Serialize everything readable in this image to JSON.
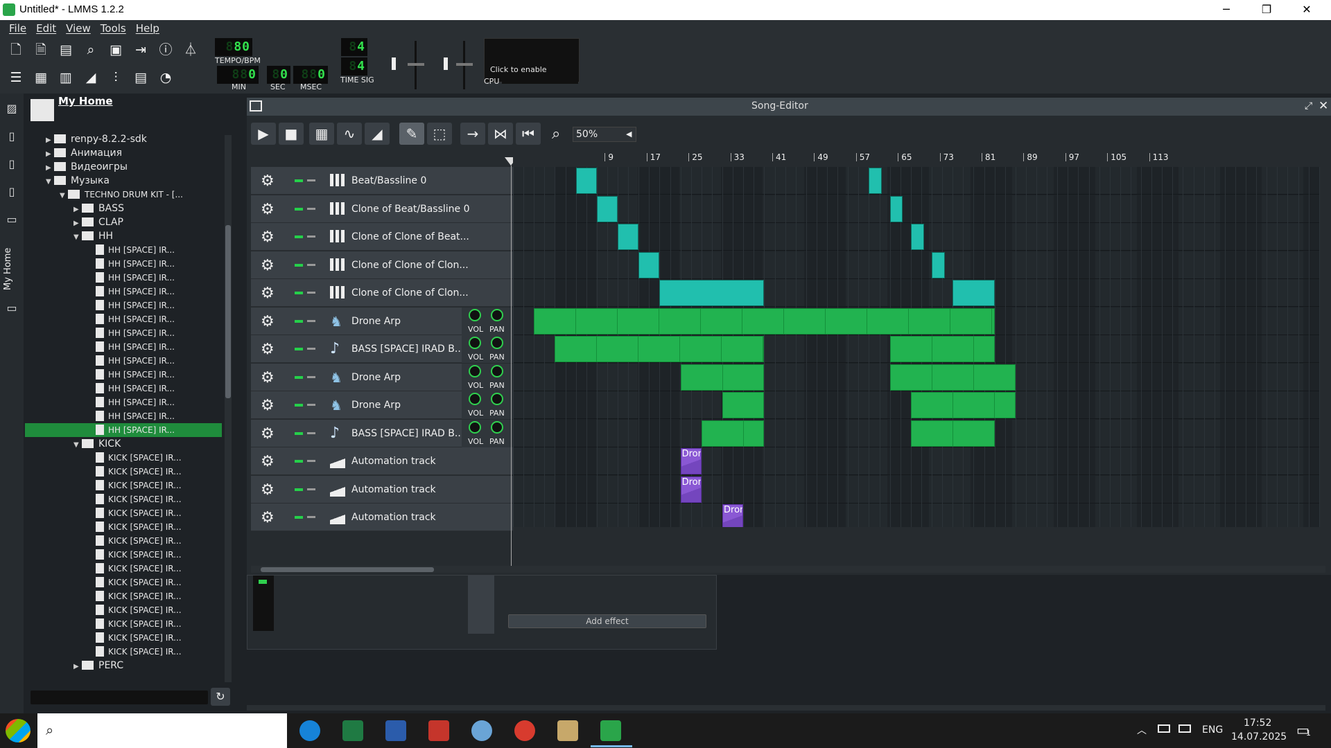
{
  "window": {
    "title": "Untitled* - LMMS 1.2.2",
    "controls": [
      "─",
      "❐",
      "✕"
    ]
  },
  "menu": [
    "File",
    "Edit",
    "View",
    "Tools",
    "Help"
  ],
  "transport": {
    "tempo_value": "80",
    "tempo_label": "TEMPO/BPM",
    "min_value": "0",
    "min_label": "MIN",
    "sec_value": "0",
    "sec_label": "SEC",
    "msec_value": "0",
    "msec_label": "MSEC",
    "timesig_num": "4",
    "timesig_den": "4",
    "timesig_label": "TIME SIG",
    "cpu_hint": "Click to enable",
    "cpu_label": "CPU"
  },
  "browser": {
    "title": "My Home",
    "side_tab_label": "My Home",
    "rows": [
      {
        "label": "renpy-8.2.2-sdk",
        "kind": "folder",
        "arrow": "▶",
        "level": 0
      },
      {
        "label": "Анимация",
        "kind": "folder",
        "arrow": "▶",
        "level": 0
      },
      {
        "label": "Видеоигры",
        "kind": "folder",
        "arrow": "▶",
        "level": 0
      },
      {
        "label": "Музыка",
        "kind": "folder",
        "arrow": "▼",
        "level": 0
      },
      {
        "label": "TECHNO DRUM KIT - [...",
        "kind": "folder",
        "arrow": "▼",
        "level": 1
      },
      {
        "label": "BASS",
        "kind": "folder",
        "arrow": "▶",
        "level": 2
      },
      {
        "label": "CLAP",
        "kind": "folder",
        "arrow": "▶",
        "level": 2
      },
      {
        "label": "HH",
        "kind": "folder",
        "arrow": "▼",
        "level": 2
      },
      {
        "label": "HH [SPACE] IR...",
        "kind": "file",
        "arrow": "",
        "level": 3
      },
      {
        "label": "HH [SPACE] IR...",
        "kind": "file",
        "arrow": "",
        "level": 3
      },
      {
        "label": "HH [SPACE] IR...",
        "kind": "file",
        "arrow": "",
        "level": 3
      },
      {
        "label": "HH [SPACE] IR...",
        "kind": "file",
        "arrow": "",
        "level": 3
      },
      {
        "label": "HH [SPACE] IR...",
        "kind": "file",
        "arrow": "",
        "level": 3
      },
      {
        "label": "HH [SPACE] IR...",
        "kind": "file",
        "arrow": "",
        "level": 3
      },
      {
        "label": "HH [SPACE] IR...",
        "kind": "file",
        "arrow": "",
        "level": 3
      },
      {
        "label": "HH [SPACE] IR...",
        "kind": "file",
        "arrow": "",
        "level": 3
      },
      {
        "label": "HH [SPACE] IR...",
        "kind": "file",
        "arrow": "",
        "level": 3
      },
      {
        "label": "HH [SPACE] IR...",
        "kind": "file",
        "arrow": "",
        "level": 3
      },
      {
        "label": "HH [SPACE] IR...",
        "kind": "file",
        "arrow": "",
        "level": 3
      },
      {
        "label": "HH [SPACE] IR...",
        "kind": "file",
        "arrow": "",
        "level": 3
      },
      {
        "label": "HH [SPACE] IR...",
        "kind": "file",
        "arrow": "",
        "level": 3
      },
      {
        "label": "HH [SPACE] IR...",
        "kind": "file",
        "arrow": "",
        "level": 3,
        "selected": true
      },
      {
        "label": "KICK",
        "kind": "folder",
        "arrow": "▼",
        "level": 2
      },
      {
        "label": "KICK [SPACE] IR...",
        "kind": "file",
        "arrow": "",
        "level": 3
      },
      {
        "label": "KICK [SPACE] IR...",
        "kind": "file",
        "arrow": "",
        "level": 3
      },
      {
        "label": "KICK [SPACE] IR...",
        "kind": "file",
        "arrow": "",
        "level": 3
      },
      {
        "label": "KICK [SPACE] IR...",
        "kind": "file",
        "arrow": "",
        "level": 3
      },
      {
        "label": "KICK [SPACE] IR...",
        "kind": "file",
        "arrow": "",
        "level": 3
      },
      {
        "label": "KICK [SPACE] IR...",
        "kind": "file",
        "arrow": "",
        "level": 3
      },
      {
        "label": "KICK [SPACE] IR...",
        "kind": "file",
        "arrow": "",
        "level": 3
      },
      {
        "label": "KICK [SPACE] IR...",
        "kind": "file",
        "arrow": "",
        "level": 3
      },
      {
        "label": "KICK [SPACE] IR...",
        "kind": "file",
        "arrow": "",
        "level": 3
      },
      {
        "label": "KICK [SPACE] IR...",
        "kind": "file",
        "arrow": "",
        "level": 3
      },
      {
        "label": "KICK [SPACE] IR...",
        "kind": "file",
        "arrow": "",
        "level": 3
      },
      {
        "label": "KICK [SPACE] IR...",
        "kind": "file",
        "arrow": "",
        "level": 3
      },
      {
        "label": "KICK [SPACE] IR...",
        "kind": "file",
        "arrow": "",
        "level": 3
      },
      {
        "label": "KICK [SPACE] IR...",
        "kind": "file",
        "arrow": "",
        "level": 3
      },
      {
        "label": "KICK [SPACE] IR...",
        "kind": "file",
        "arrow": "",
        "level": 3
      },
      {
        "label": "PERC",
        "kind": "folder",
        "arrow": "▶",
        "level": 2
      }
    ]
  },
  "song_editor": {
    "title": "Song-Editor",
    "zoom": "50%",
    "ruler": [
      "9",
      "17",
      "25",
      "33",
      "41",
      "49",
      "57",
      "65",
      "73",
      "81",
      "89",
      "97",
      "105",
      "113"
    ],
    "tracks": [
      {
        "name": "Beat/Bassline 0",
        "type": "beat"
      },
      {
        "name": "Clone of Beat/Bassline 0",
        "type": "beat"
      },
      {
        "name": "Clone of Clone of Beat...",
        "type": "beat"
      },
      {
        "name": "Clone of Clone of Clon...",
        "type": "beat"
      },
      {
        "name": "Clone of Clone of Clon...",
        "type": "beat"
      },
      {
        "name": "Drone Arp",
        "type": "inst"
      },
      {
        "name": "BASS [SPACE] IRAD B...",
        "type": "sample"
      },
      {
        "name": "Drone Arp",
        "type": "inst"
      },
      {
        "name": "Drone Arp",
        "type": "inst"
      },
      {
        "name": "BASS [SPACE] IRAD B...",
        "type": "sample"
      },
      {
        "name": "Automation track",
        "type": "auto"
      },
      {
        "name": "Automation track",
        "type": "auto"
      },
      {
        "name": "Automation track",
        "type": "auto"
      }
    ],
    "vol_label": "VOL",
    "pan_label": "PAN",
    "clips": [
      {
        "track": 0,
        "start": 13,
        "end": 17,
        "kind": "beat"
      },
      {
        "track": 0,
        "start": 69,
        "end": 71.5,
        "kind": "beat"
      },
      {
        "track": 1,
        "start": 17,
        "end": 21,
        "kind": "beat"
      },
      {
        "track": 1,
        "start": 73,
        "end": 75.5,
        "kind": "beat"
      },
      {
        "track": 2,
        "start": 21,
        "end": 25,
        "kind": "beat"
      },
      {
        "track": 2,
        "start": 77,
        "end": 79.5,
        "kind": "beat"
      },
      {
        "track": 3,
        "start": 25,
        "end": 29,
        "kind": "beat"
      },
      {
        "track": 3,
        "start": 81,
        "end": 83.5,
        "kind": "beat"
      },
      {
        "track": 4,
        "start": 29,
        "end": 49,
        "kind": "beat"
      },
      {
        "track": 4,
        "start": 85,
        "end": 93,
        "kind": "beat"
      },
      {
        "track": 5,
        "start": 5,
        "end": 93,
        "kind": "inst"
      },
      {
        "track": 6,
        "start": 9,
        "end": 49,
        "kind": "inst"
      },
      {
        "track": 6,
        "start": 73,
        "end": 93,
        "kind": "inst"
      },
      {
        "track": 7,
        "start": 33,
        "end": 49,
        "kind": "inst"
      },
      {
        "track": 7,
        "start": 73,
        "end": 97,
        "kind": "inst"
      },
      {
        "track": 8,
        "start": 41,
        "end": 49,
        "kind": "inst"
      },
      {
        "track": 8,
        "start": 77,
        "end": 97,
        "kind": "inst"
      },
      {
        "track": 9,
        "start": 37,
        "end": 49,
        "kind": "inst"
      },
      {
        "track": 9,
        "start": 77,
        "end": 93,
        "kind": "inst"
      },
      {
        "track": 10,
        "start": 33,
        "end": 37,
        "kind": "auto",
        "label": "Drone Ar"
      },
      {
        "track": 11,
        "start": 33,
        "end": 37,
        "kind": "auto",
        "label": "Drone Ar"
      },
      {
        "track": 12,
        "start": 41,
        "end": 45,
        "kind": "auto",
        "label": "Drone Ar"
      }
    ]
  },
  "mixer": {
    "add_effect": "Add effect"
  },
  "taskbar": {
    "lang": "ENG",
    "time": "17:52",
    "date": "14.07.2025",
    "notifications": "1"
  },
  "colors": {
    "beat_clip": "#21bfae",
    "inst_clip": "#22b350",
    "auto_clip": "#8a58d4",
    "selection": "#1f8c3c",
    "lcd": "#32e04d"
  }
}
